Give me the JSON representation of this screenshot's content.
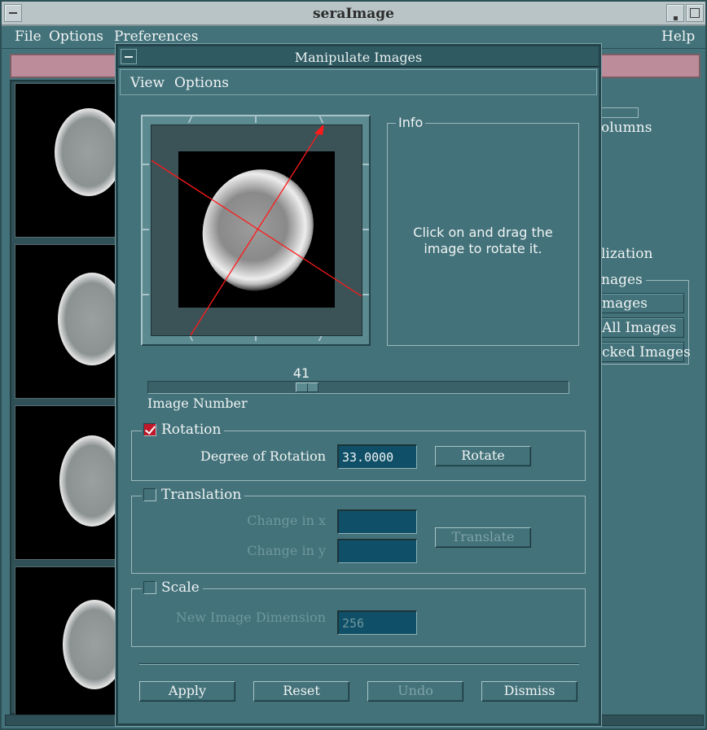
{
  "main_window": {
    "title": "seraImage",
    "menu": {
      "file": "File",
      "options": "Options",
      "preferences": "Preferences",
      "help": "Help"
    }
  },
  "side_panel": {
    "columns_text": "olumns",
    "visualization_text": "lization",
    "images_group": "nages",
    "buttons": [
      "mages",
      "All Images",
      "cked Images"
    ]
  },
  "dialog": {
    "title": "Manipulate Images",
    "menu": {
      "view": "View",
      "options": "Options"
    },
    "info": {
      "legend": "Info",
      "text": "Click on and drag the image to rotate it."
    },
    "slider": {
      "value": "41",
      "label": "Image Number",
      "position": 0.37
    },
    "rotation": {
      "label": "Rotation",
      "checked": true,
      "degree_label": "Degree of Rotation",
      "degree_value": "33.0000",
      "button": "Rotate"
    },
    "translation": {
      "label": "Translation",
      "checked": false,
      "x_label": "Change in x",
      "x_value": "",
      "y_label": "Change in y",
      "y_value": "",
      "button": "Translate"
    },
    "scale": {
      "label": "Scale",
      "checked": false,
      "dim_label": "New Image Dimension",
      "dim_value": "256"
    },
    "buttons": {
      "apply": "Apply",
      "reset": "Reset",
      "undo": "Undo",
      "dismiss": "Dismiss"
    }
  },
  "colors": {
    "background": "#43727a",
    "input_bg": "#0f4f67",
    "highlight_bar": "#bd8c9a",
    "rotation_line": "#ff1a1a",
    "checkbox_on": "#c0182a"
  }
}
